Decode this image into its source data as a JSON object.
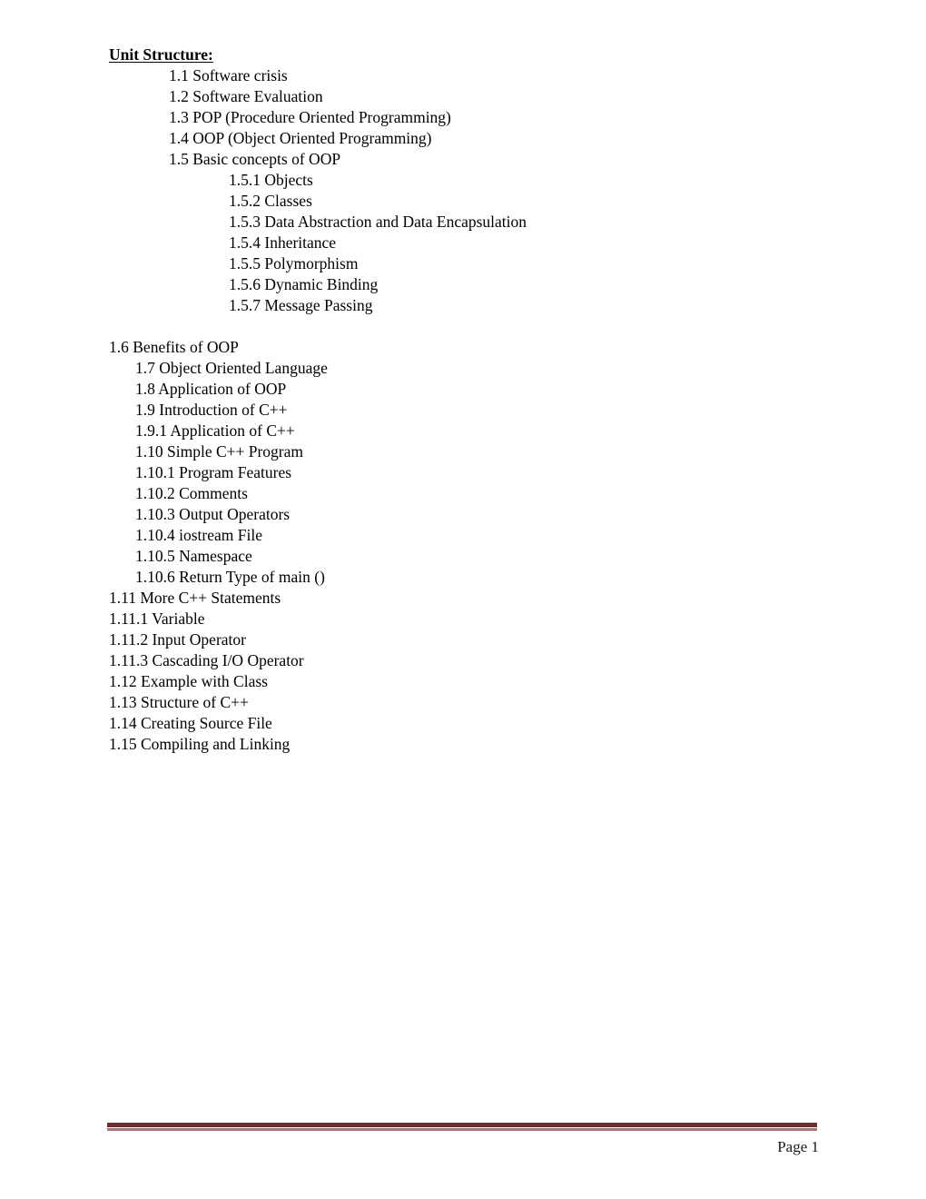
{
  "document": {
    "title": "Unit Structure:",
    "entries": [
      {
        "text": "1.1 Software crisis",
        "level": 2
      },
      {
        "text": "1.2 Software Evaluation",
        "level": 2
      },
      {
        "text": "1.3 POP (Procedure Oriented Programming)",
        "level": 2
      },
      {
        "text": "1.4 OOP (Object Oriented Programming)",
        "level": 2
      },
      {
        "text": "1.5 Basic concepts of OOP",
        "level": 2
      },
      {
        "text": "1.5.1 Objects",
        "level": 3
      },
      {
        "text": "1.5.2 Classes",
        "level": 3
      },
      {
        "text": "1.5.3 Data Abstraction and Data Encapsulation",
        "level": 3
      },
      {
        "text": "1.5.4 Inheritance",
        "level": 3
      },
      {
        "text": "1.5.5 Polymorphism",
        "level": 3
      },
      {
        "text": "1.5.6 Dynamic Binding",
        "level": 3
      },
      {
        "text": "1.5.7 Message Passing",
        "level": 3
      },
      {
        "text": "",
        "level": 0,
        "spacer": true
      },
      {
        "text": "1.6 Benefits of OOP",
        "level": 0
      },
      {
        "text": "1.7 Object Oriented Language",
        "level": 1
      },
      {
        "text": "1.8 Application of OOP",
        "level": 1
      },
      {
        "text": "1.9 Introduction of C++",
        "level": 1
      },
      {
        "text": "1.9.1 Application of C++",
        "level": 1
      },
      {
        "text": "1.10 Simple C++ Program",
        "level": 1
      },
      {
        "text": "1.10.1 Program Features",
        "level": 1
      },
      {
        "text": "1.10.2 Comments",
        "level": 1
      },
      {
        "text": "1.10.3 Output Operators",
        "level": 1
      },
      {
        "text": "1.10.4 iostream File",
        "level": 1
      },
      {
        "text": "1.10.5 Namespace",
        "level": 1
      },
      {
        "text": "1.10.6 Return Type of main ()",
        "level": 1
      },
      {
        "text": "1.11 More C++ Statements",
        "level": 0
      },
      {
        "text": "1.11.1 Variable",
        "level": 0
      },
      {
        "text": "1.11.2 Input Operator",
        "level": 0
      },
      {
        "text": "1.11.3 Cascading I/O Operator",
        "level": 0
      },
      {
        "text": "1.12 Example with Class",
        "level": 0
      },
      {
        "text": "1.13 Structure of C++",
        "level": 0
      },
      {
        "text": "1.14 Creating Source File",
        "level": 0
      },
      {
        "text": "1.15 Compiling and Linking",
        "level": 0
      }
    ]
  },
  "footer": {
    "page_label": "Page 1",
    "rule_color_thick": "#6b2f32",
    "rule_color_thin": "#a9777a"
  }
}
